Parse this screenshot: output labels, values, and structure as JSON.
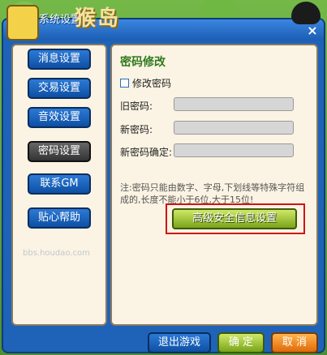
{
  "window": {
    "title": "系统设置",
    "close_glyph": "×",
    "watermark": "猴岛",
    "watermark_url": "bbs.houdao.com"
  },
  "sidebar": {
    "items": [
      {
        "label": "消息设置",
        "active": false
      },
      {
        "label": "交易设置",
        "active": false
      },
      {
        "label": "音效设置",
        "active": false
      },
      {
        "label": "密码设置",
        "active": true
      },
      {
        "label": "联系GM",
        "active": false
      },
      {
        "label": "贴心帮助",
        "active": false
      }
    ]
  },
  "content": {
    "section_title": "密码修改",
    "change_password_checkbox": "修改密码",
    "old_password_label": "旧密码:",
    "new_password_label": "新密码:",
    "confirm_password_label": "新密码确定:",
    "note": "注:密码只能由数字、字母,下划线等特殊字符组成的,长度不能小于6位,大于15位!",
    "advanced_button": "高级安全信息设置"
  },
  "footer": {
    "exit_label": "退出游戏",
    "ok_label": "确 定",
    "cancel_label": "取 消"
  }
}
